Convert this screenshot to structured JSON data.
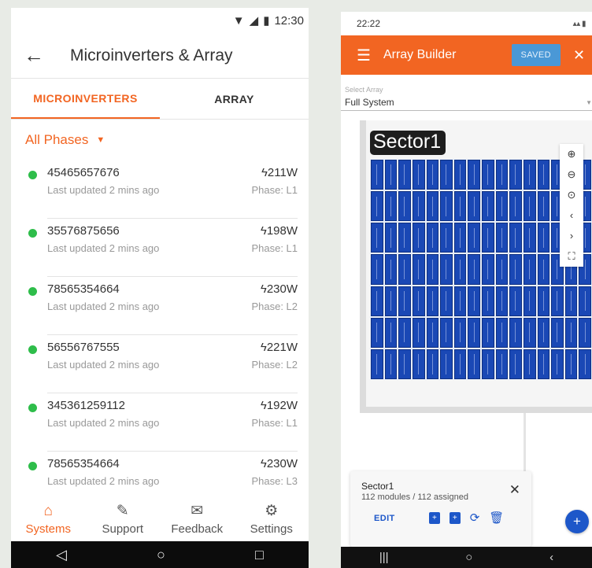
{
  "left": {
    "status": {
      "time": "12:30"
    },
    "title": "Microinverters & Array",
    "tabs": [
      "MICROINVERTERS",
      "ARRAY"
    ],
    "phase_filter": "All Phases",
    "items": [
      {
        "serial": "45465657676",
        "updated": "Last updated 2 mins ago",
        "power": "211W",
        "phase": "Phase: L1"
      },
      {
        "serial": "35576875656",
        "updated": "Last updated 2 mins ago",
        "power": "198W",
        "phase": "Phase: L1"
      },
      {
        "serial": "78565354664",
        "updated": "Last updated 2 mins ago",
        "power": "230W",
        "phase": "Phase: L2"
      },
      {
        "serial": "56556767555",
        "updated": "Last updated 2 mins ago",
        "power": "221W",
        "phase": "Phase: L2"
      },
      {
        "serial": "345361259112",
        "updated": "Last updated 2 mins ago",
        "power": "192W",
        "phase": "Phase: L1"
      },
      {
        "serial": "78565354664",
        "updated": "Last updated 2 mins ago",
        "power": "230W",
        "phase": "Phase: L3"
      }
    ],
    "nav": [
      "Systems",
      "Support",
      "Feedback",
      "Settings"
    ],
    "accent": "#f26522",
    "online_color": "#2ebd4a"
  },
  "right": {
    "status": {
      "time": "22:22"
    },
    "title": "Array Builder",
    "saved_label": "SAVED",
    "select_label": "Select Array",
    "select_value": "Full System",
    "sector_label": "Sector1",
    "sheet": {
      "title": "Sector1",
      "subtitle": "112 modules / 112 assigned",
      "edit_label": "EDIT"
    },
    "grid": {
      "rows": 7,
      "cols": 16
    },
    "module_color": "#1a48b5",
    "accent": "#f26522"
  }
}
